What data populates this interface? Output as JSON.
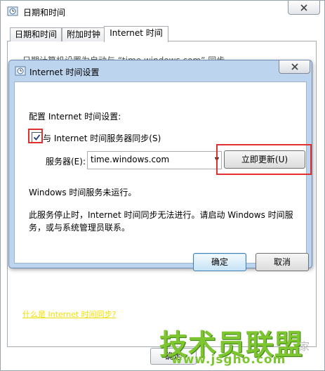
{
  "outer_window": {
    "title": "日期和时间",
    "tabs": [
      {
        "label": "日期和时间"
      },
      {
        "label": "附加时钟"
      },
      {
        "label": "Internet 时间"
      }
    ],
    "partial_text": "日期计算机设置为自动与 “time.windows.com” 同步",
    "link": "什么是 Internet 时间同步?",
    "ok_label": "确定"
  },
  "dialog": {
    "title": "Internet 时间设置",
    "config_label": "配置 Internet 时间设置:",
    "sync_checkbox": {
      "label": "与 Internet 时间服务器同步(S)",
      "checked": true
    },
    "server": {
      "label": "服务器(E):",
      "value": "time.windows.com"
    },
    "update_button": "立即更新(U)",
    "status": "Windows 时间服务未运行。",
    "description": "此服务停止时，Internet 时间同步无法进行。请启动 Windows 时间服务，或与系统管理员联系。",
    "ok": "确定",
    "cancel": "取消"
  },
  "watermark": {
    "text": "技术员联盟",
    "url": "www.jsgho.com",
    "extra": "家"
  },
  "colors": {
    "highlight": "#e03030",
    "dialog_frame": "#bcd4ee",
    "watermark": "#7dc62f"
  }
}
